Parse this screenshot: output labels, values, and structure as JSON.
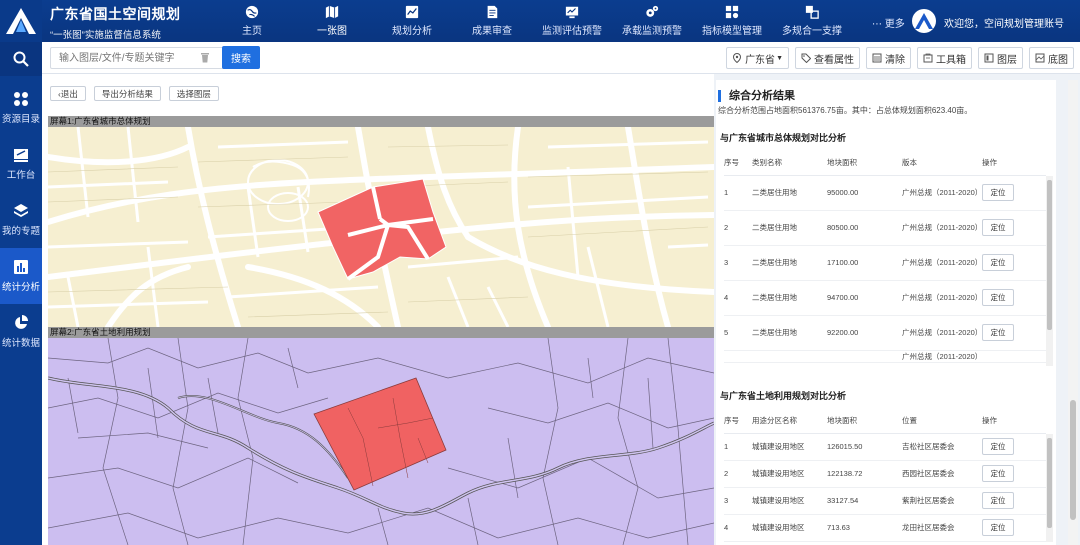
{
  "app": {
    "title": "广东省国土空间规划",
    "subtitle": "“一张图”实施监督信息系统"
  },
  "nav": {
    "items": [
      {
        "label": "主页",
        "icon": "globe-icon"
      },
      {
        "label": "一张图",
        "icon": "map-icon"
      },
      {
        "label": "规划分析",
        "icon": "chart-icon"
      },
      {
        "label": "成果审查",
        "icon": "document-icon"
      },
      {
        "label": "监测评估预警",
        "icon": "monitor-icon"
      },
      {
        "label": "承载监测预警",
        "icon": "gears-icon"
      },
      {
        "label": "指标模型管理",
        "icon": "model-icon"
      },
      {
        "label": "多规合一支撑",
        "icon": "layers-icon"
      }
    ],
    "more": "更多",
    "welcome": "欢迎您，空间规划管理账号"
  },
  "sidebar": {
    "items": [
      {
        "label": "资源目录",
        "icon": "grid-icon"
      },
      {
        "label": "工作台",
        "icon": "desk-icon"
      },
      {
        "label": "我的专题",
        "icon": "layers-icon"
      },
      {
        "label": "统计分析",
        "icon": "bar-chart-icon"
      },
      {
        "label": "统计数据",
        "icon": "pie-chart-icon"
      }
    ]
  },
  "toolbar": {
    "search_placeholder": "输入图层/文件/专题关键字",
    "search_label": "搜索",
    "region": "广东省",
    "tools": [
      "查看属性",
      "清除",
      "工具箱",
      "图层",
      "底图"
    ]
  },
  "main": {
    "buttons": [
      "‹退出",
      "导出分析结果",
      "选择图层"
    ],
    "screen1": "屏幕1:广东省城市总体规划",
    "screen2": "屏幕2:广东省土地利用规划"
  },
  "panel": {
    "title": "综合分析结果",
    "desc": "综合分析范围占地面积561376.75亩。其中：占总体规划面积623.40亩。",
    "sec1": "与广东省城市总体规划对比分析",
    "table1": {
      "headers": [
        "序号",
        "类别名称",
        "地块面积",
        "版本",
        "操作"
      ],
      "rows": [
        [
          "1",
          "二类居住用地",
          "95000.00",
          "广州总规（2011-2020）",
          "定位"
        ],
        [
          "2",
          "二类居住用地",
          "80500.00",
          "广州总规（2011-2020）",
          "定位"
        ],
        [
          "3",
          "二类居住用地",
          "17100.00",
          "广州总规（2011-2020）",
          "定位"
        ],
        [
          "4",
          "二类居住用地",
          "94700.00",
          "广州总规（2011-2020）",
          "定位"
        ],
        [
          "5",
          "二类居住用地",
          "92200.00",
          "广州总规（2011-2020）",
          "定位"
        ],
        [
          "",
          "",
          "",
          "广州总规（2011-2020）",
          ""
        ]
      ]
    },
    "sec2": "与广东省土地利用规划对比分析",
    "table2": {
      "headers": [
        "序号",
        "用途分区名称",
        "地块面积",
        "位置",
        "操作"
      ],
      "rows": [
        [
          "1",
          "城镇建设用地区",
          "126015.50",
          "吉松社区居委会",
          "定位"
        ],
        [
          "2",
          "城镇建设用地区",
          "122138.72",
          "西园社区居委会",
          "定位"
        ],
        [
          "3",
          "城镇建设用地区",
          "33127.54",
          "紫荆社区居委会",
          "定位"
        ],
        [
          "4",
          "城镇建设用地区",
          "713.63",
          "龙田社区居委会",
          "定位"
        ]
      ]
    }
  }
}
